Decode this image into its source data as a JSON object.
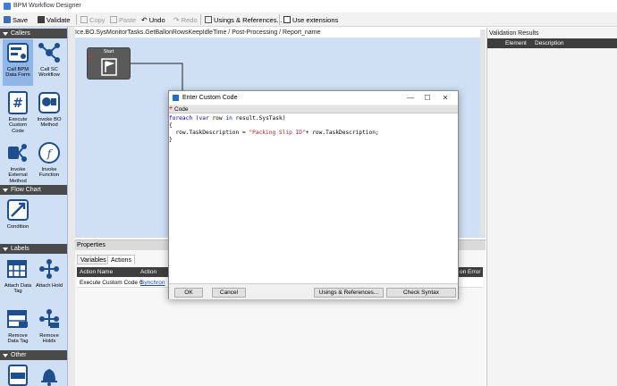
{
  "window": {
    "title": "BPM Workflow Designer"
  },
  "toolbar": {
    "save": "Save",
    "validate": "Validate",
    "copy": "Copy",
    "paste": "Paste",
    "undo": "Undo",
    "redo": "Redo",
    "usings": "Usings & References...",
    "use_ext": "Use extensions"
  },
  "palette": {
    "callers": {
      "title": "Callers",
      "items": [
        "Call BPM Data Form",
        "Call SC Workflow",
        "Execute Custom Code",
        "Invoke BO Method",
        "Invoke External Method",
        "Invoke Function"
      ]
    },
    "flowchart": {
      "title": "Flow Chart",
      "items": [
        "Condition"
      ]
    },
    "labels": {
      "title": "Labels",
      "items": [
        "Attach Data Tag",
        "Attach Hold",
        "Remove Data Tag",
        "Remove Holds"
      ]
    },
    "other": {
      "title": "Other",
      "icons": [
        "log-icon",
        "bell-icon"
      ]
    }
  },
  "breadcrumb": "Ice.BO.SysMonitorTasks.GetBallonRowsKeepIdleTime / Post-Processing / Report_name",
  "start_node": {
    "label": "Start"
  },
  "validation": {
    "title": "Validation Results",
    "col_element": "Element",
    "col_description": "Description"
  },
  "properties": {
    "title": "Properties",
    "tabs": [
      "Variables",
      "Actions"
    ],
    "col_action_name": "Action Name",
    "col_action": "Action",
    "col_error": "on Error",
    "row": {
      "name": "Execute Custom Code 0",
      "action": "Synchron"
    }
  },
  "dialog": {
    "title": "Enter Custom Code",
    "code_label": "Code",
    "code": {
      "l1_kw1": "foreach",
      "l1_mid": " (",
      "l1_kw2": "var",
      "l1_mid2": " row ",
      "l1_kw3": "in",
      "l1_rest": " result.SysTask)",
      "l2": "{",
      "l3_pre": "  row.TaskDescription = ",
      "l3_str": "\"Packing Slip ID\"",
      "l3_post": "+ row.TaskDescription;",
      "l4": "}"
    },
    "ok": "OK",
    "cancel": "Cancel",
    "usings": "Usings & References...",
    "check_syntax": "Check Syntax"
  }
}
